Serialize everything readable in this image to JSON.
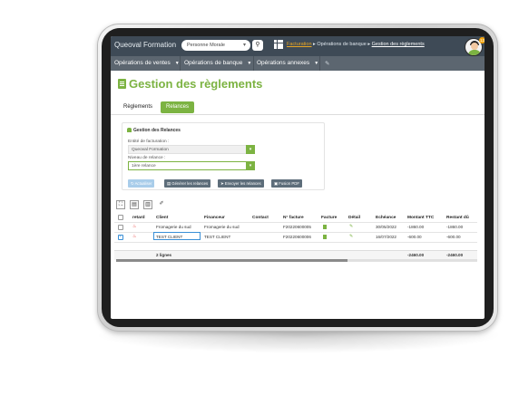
{
  "header": {
    "brand": "Queoval Formation",
    "entity_select": "Personne Morale",
    "breadcrumb": {
      "b1": "Facturation",
      "b2": "Opérations de banque",
      "b3": "Gestion des règlements"
    },
    "notif_count": "13"
  },
  "menu": [
    {
      "label": "Opérations de ventes"
    },
    {
      "label": "Opérations de banque"
    },
    {
      "label": "Opérations annexes"
    }
  ],
  "page": {
    "title": "Gestion des règlements",
    "tabs": [
      "Règlements",
      "Relances"
    ],
    "active_tab": "Relances"
  },
  "panel": {
    "title": "Gestion des Relances",
    "entity_label": "Entité de facturation :",
    "entity_value": "Queoval Formation",
    "level_label": "Niveau de relance :",
    "level_value": "1ère relance",
    "buttons": [
      "Actualiser",
      "Générer les relances",
      "Envoyer les relances",
      "Fusion PDF"
    ]
  },
  "table": {
    "headers": [
      "retard",
      "Client",
      "Financeur",
      "Contact",
      "N° facture",
      "Facture",
      "Détail",
      "Echéance",
      "Montant TTC",
      "Restant dû"
    ],
    "rows": [
      {
        "client": "Fromagerie du sud",
        "financeur": "Fromagerie du sud",
        "contact": "",
        "facture_no": "F20220600005",
        "echeance": "30/05/2022",
        "montant": "-1860.00",
        "restant": "-1860.00",
        "checked": false
      },
      {
        "client": "TEST CLIENT",
        "financeur": "TEST CLIENT",
        "contact": "",
        "facture_no": "F20220600006",
        "echeance": "16/07/2022",
        "montant": "-600.00",
        "restant": "-600.00",
        "checked": true
      }
    ],
    "footer": {
      "count": "2 lignes",
      "montant_total": "-2460.00",
      "restant_total": "-2460.00"
    }
  },
  "colors": {
    "accent": "#7cb342",
    "topbar": "#3e4a56",
    "menubar": "#5c6670"
  }
}
